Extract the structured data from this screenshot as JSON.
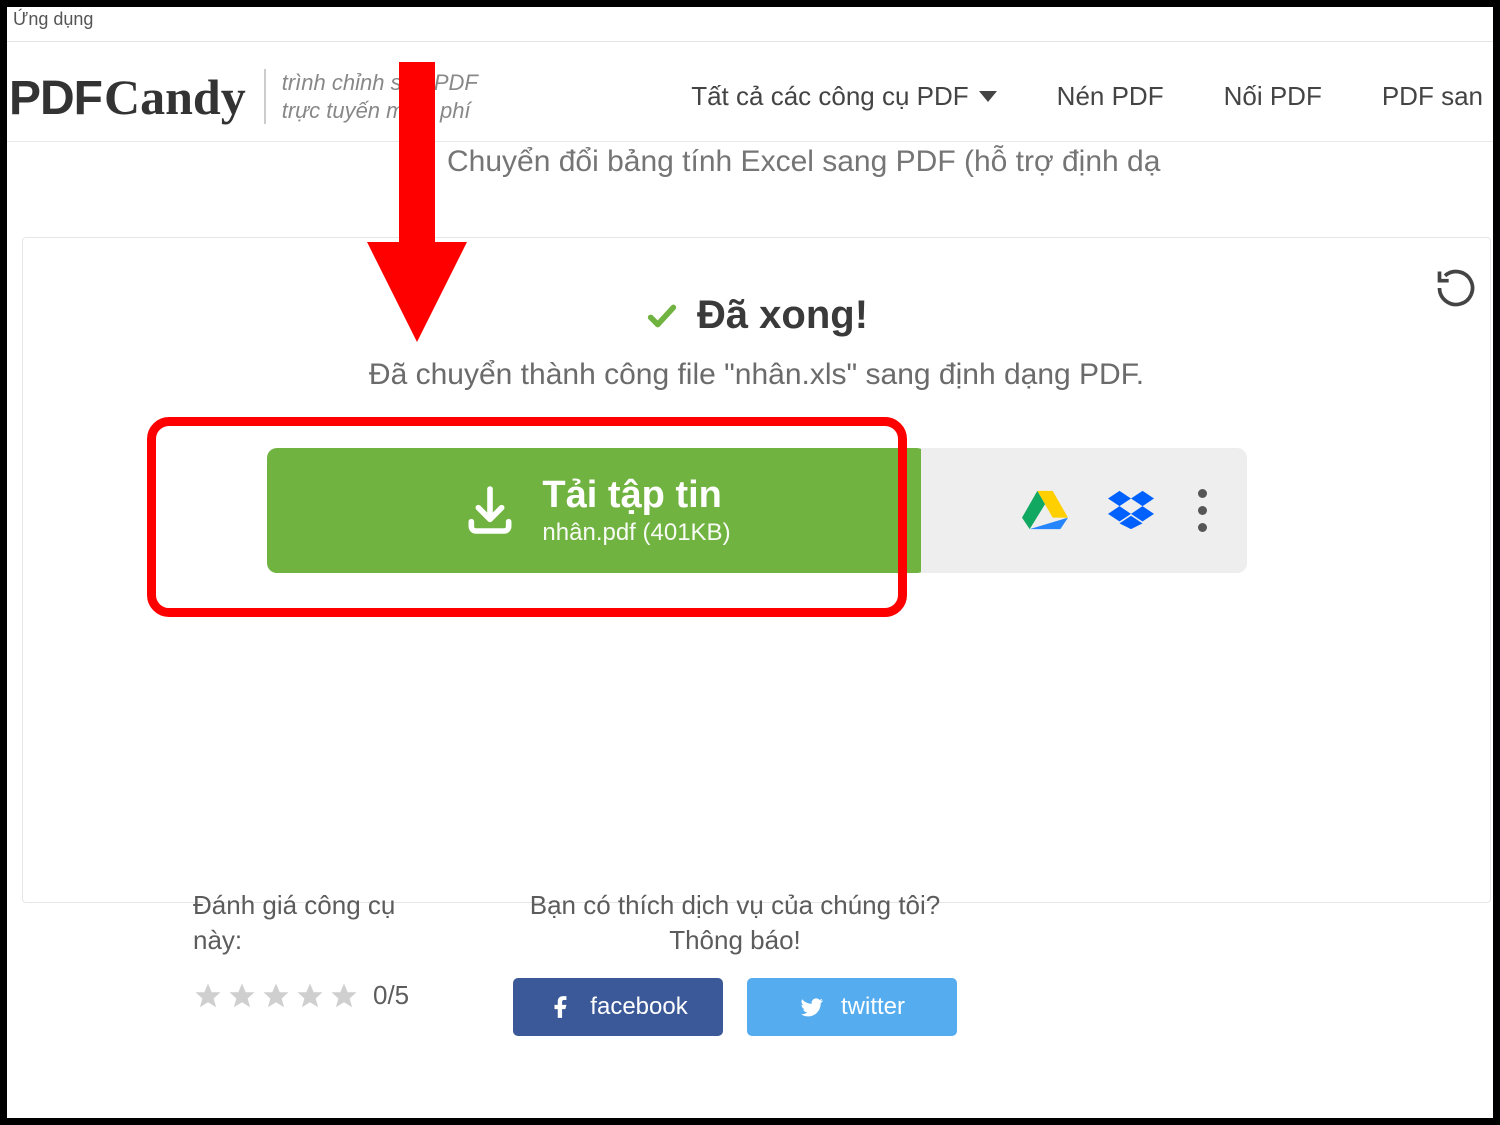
{
  "window": {
    "app_label": "Ứng dụng"
  },
  "header": {
    "logo_main": "PDF",
    "logo_cursive": "Candy",
    "tagline_line1": "trình chỉnh sửa PDF",
    "tagline_line2": "trực tuyến miễn phí",
    "nav": {
      "all_tools": "Tất cả các công cụ PDF",
      "compress": "Nén PDF",
      "merge": "Nối PDF",
      "pdf_to": "PDF san"
    }
  },
  "page": {
    "subtitle_partial": "Chuyển đổi bảng tính Excel sang PDF (hỗ trợ định dạ"
  },
  "result": {
    "done_label": "Đã xong!",
    "success_message": "Đã chuyển thành công file \"nhân.xls\" sang định dạng PDF.",
    "download": {
      "title": "Tải tập tin",
      "file_info": "nhân.pdf (401KB)"
    }
  },
  "footer": {
    "rate_label": "Đánh giá công cụ này:",
    "rate_score": "0/5",
    "share_line1": "Bạn có thích dịch vụ của chúng tôi?",
    "share_line2": "Thông báo!",
    "facebook": "facebook",
    "twitter": "twitter"
  },
  "colors": {
    "accent_green": "#71b340",
    "highlight_red": "#ff0000",
    "fb": "#3b5998",
    "tw": "#55acee"
  }
}
